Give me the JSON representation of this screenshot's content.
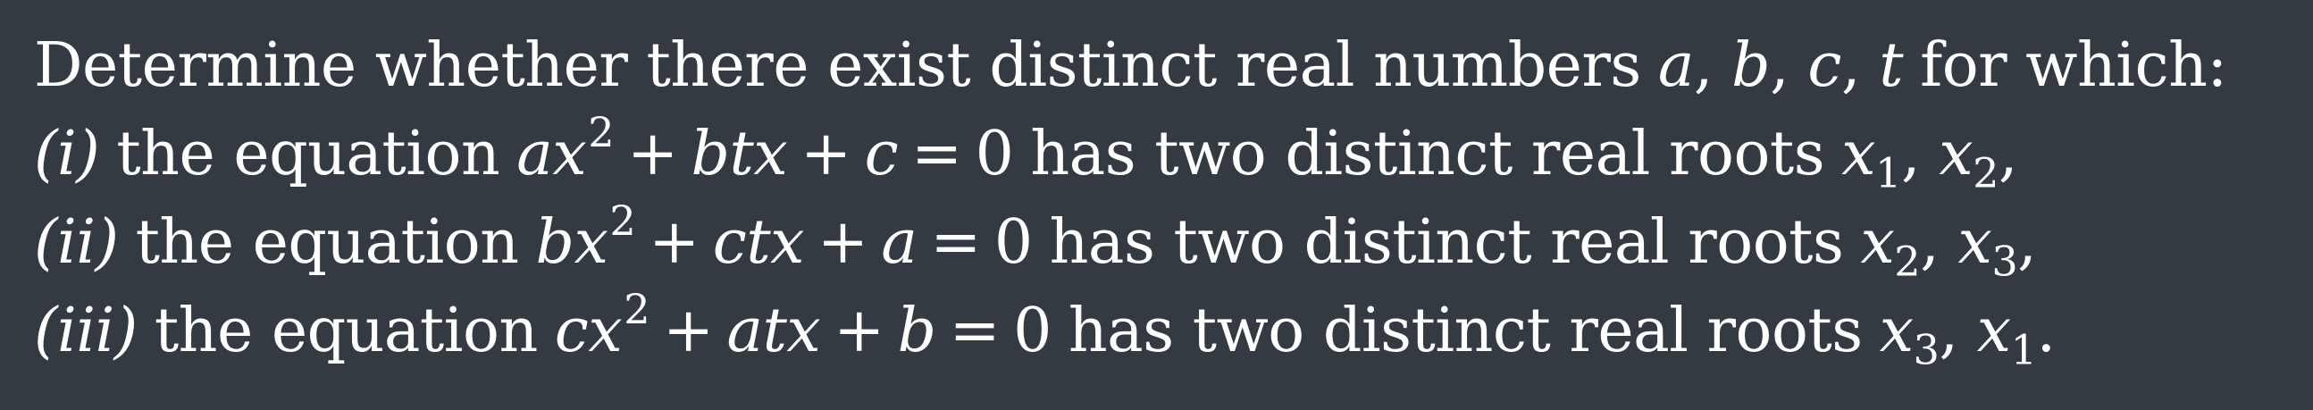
{
  "problem": {
    "intro": {
      "text": "Determine whether there exist distinct real numbers",
      "variables": "a, b, c, t",
      "tail": "for which:"
    },
    "items": [
      {
        "marker": "(i)",
        "prefix": "the equation",
        "equation": "ax² + btx + c = 0",
        "middle": "has two distinct real roots",
        "roots": "x₁, x₂,"
      },
      {
        "marker": "(ii)",
        "prefix": "the equation",
        "equation": "bx² + ctx + a = 0",
        "middle": "has two distinct real roots",
        "roots": "x₂, x₃,"
      },
      {
        "marker": "(iii)",
        "prefix": "the equation",
        "equation": "cx² + atx + b = 0",
        "middle": "has two distinct real roots",
        "roots": "x₃, x₁."
      }
    ]
  }
}
